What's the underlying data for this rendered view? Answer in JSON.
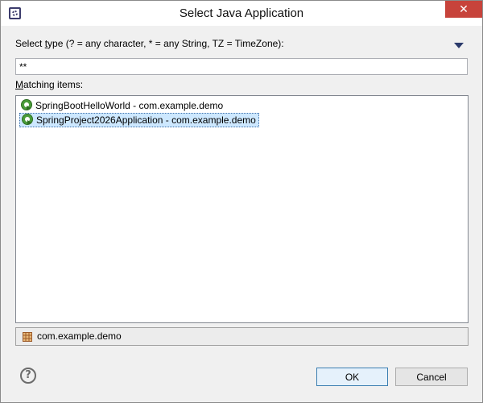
{
  "window": {
    "title": "Select Java Application",
    "close_glyph": "✕"
  },
  "filter": {
    "label_prefix": "Select ",
    "label_mnemonic": "t",
    "label_suffix": "ype (? = any character, * = any String, TZ = TimeZone):",
    "value": "**"
  },
  "matching": {
    "label_mnemonic": "M",
    "label_rest": "atching items:",
    "items": [
      {
        "label": "SpringBootHelloWorld - com.example.demo",
        "icon": "spring-boot-app-icon",
        "selected": false
      },
      {
        "label": "SpringProject2026Application - com.example.demo",
        "icon": "spring-boot-app-icon",
        "selected": true
      }
    ]
  },
  "details": {
    "package": "com.example.demo",
    "icon": "package-icon"
  },
  "buttons": {
    "ok": "OK",
    "cancel": "Cancel",
    "help_glyph": "?"
  }
}
